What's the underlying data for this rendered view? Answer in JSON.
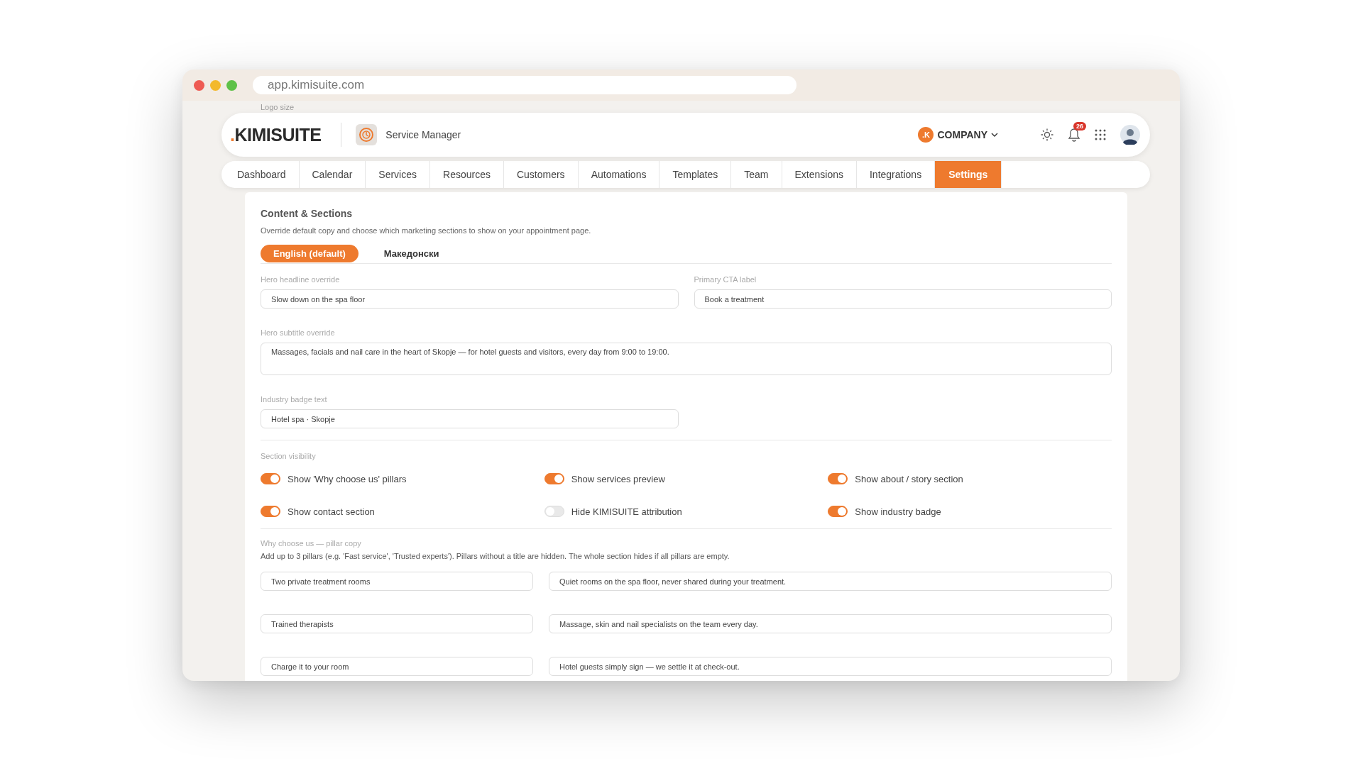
{
  "browser": {
    "url": "app.kimisuite.com"
  },
  "backdrop": {
    "label": "Logo size"
  },
  "header": {
    "logo": ".KIMISUITE",
    "app_name": "Service Manager",
    "company": {
      "initial": ".K",
      "label": "COMPANY"
    },
    "notifications": {
      "count": "26"
    }
  },
  "nav": [
    {
      "label": "Dashboard",
      "selected": false
    },
    {
      "label": "Calendar",
      "selected": false
    },
    {
      "label": "Services",
      "selected": false
    },
    {
      "label": "Resources",
      "selected": false
    },
    {
      "label": "Customers",
      "selected": false
    },
    {
      "label": "Automations",
      "selected": false
    },
    {
      "label": "Templates",
      "selected": false
    },
    {
      "label": "Team",
      "selected": false
    },
    {
      "label": "Extensions",
      "selected": false
    },
    {
      "label": "Integrations",
      "selected": false
    },
    {
      "label": "Settings",
      "selected": true
    }
  ],
  "content": {
    "title": "Content & Sections",
    "description": "Override default copy and choose which marketing sections to show on your appointment page.",
    "languages": [
      {
        "label": "English (default)",
        "selected": true
      },
      {
        "label": "Македонски",
        "selected": false
      }
    ],
    "fields": [
      {
        "kind": "text",
        "label": "Hero headline override",
        "value": "Slow down on the spa floor"
      },
      {
        "kind": "text",
        "label": "Primary CTA label",
        "value": "Book a treatment"
      },
      {
        "kind": "textarea",
        "label": "Hero subtitle override",
        "value": "Massages, facials and nail care in the heart of Skopje — for hotel guests and visitors, every day from 9:00 to 19:00."
      },
      {
        "kind": "text",
        "label": "Industry badge text",
        "value": "Hotel spa · Skopje"
      }
    ],
    "visibility": {
      "title": "Section visibility",
      "toggles": [
        {
          "label": "Show 'Why choose us' pillars",
          "on": true
        },
        {
          "label": "Show services preview",
          "on": true
        },
        {
          "label": "Show about / story section",
          "on": true
        },
        {
          "label": "Show contact section",
          "on": true
        },
        {
          "label": "Hide KIMISUITE attribution",
          "on": false
        },
        {
          "label": "Show industry badge",
          "on": true
        }
      ]
    },
    "pillars": {
      "title": "Why choose us — pillar copy",
      "description": "Add up to 3 pillars (e.g. 'Fast service', 'Trusted experts'). Pillars without a title are hidden. The whole section hides if all pillars are empty.",
      "rows": [
        {
          "title": "Two private treatment rooms",
          "text": "Quiet rooms on the spa floor, never shared during your treatment."
        },
        {
          "title": "Trained therapists",
          "text": "Massage, skin and nail specialists on the team every day."
        },
        {
          "title": "Charge it to your room",
          "text": "Hotel guests simply sign — we settle it at check-out."
        }
      ]
    }
  }
}
